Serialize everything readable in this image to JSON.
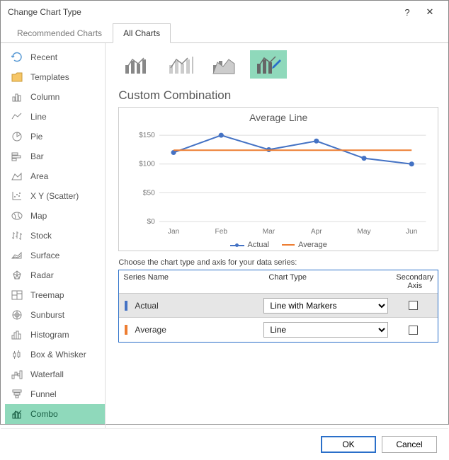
{
  "title": "Change Chart Type",
  "tabs": {
    "recommended": "Recommended Charts",
    "all": "All Charts"
  },
  "sidebar": {
    "items": [
      {
        "label": "Recent"
      },
      {
        "label": "Templates"
      },
      {
        "label": "Column"
      },
      {
        "label": "Line"
      },
      {
        "label": "Pie"
      },
      {
        "label": "Bar"
      },
      {
        "label": "Area"
      },
      {
        "label": "X Y (Scatter)"
      },
      {
        "label": "Map"
      },
      {
        "label": "Stock"
      },
      {
        "label": "Surface"
      },
      {
        "label": "Radar"
      },
      {
        "label": "Treemap"
      },
      {
        "label": "Sunburst"
      },
      {
        "label": "Histogram"
      },
      {
        "label": "Box & Whisker"
      },
      {
        "label": "Waterfall"
      },
      {
        "label": "Funnel"
      },
      {
        "label": "Combo"
      }
    ]
  },
  "section_title": "Custom Combination",
  "chart_data": {
    "type": "line",
    "title": "Average Line",
    "categories": [
      "Jan",
      "Feb",
      "Mar",
      "Apr",
      "May",
      "Jun"
    ],
    "series": [
      {
        "name": "Actual",
        "values": [
          120,
          150,
          125,
          140,
          110,
          100
        ],
        "color": "#4472c4",
        "markers": true
      },
      {
        "name": "Average",
        "values": [
          124,
          124,
          124,
          124,
          124,
          124
        ],
        "color": "#ed7d31",
        "markers": false
      }
    ],
    "yticks": [
      "$0",
      "$50",
      "$100",
      "$150"
    ],
    "ylim": [
      0,
      160
    ]
  },
  "series_section_label": "Choose the chart type and axis for your data series:",
  "series_columns": {
    "name": "Series Name",
    "type": "Chart Type",
    "axis": "Secondary Axis"
  },
  "series_rows": [
    {
      "swatch": "#4472c4",
      "name": "Actual",
      "type": "Line with Markers",
      "secondary": false
    },
    {
      "swatch": "#ed7d31",
      "name": "Average",
      "type": "Line",
      "secondary": false
    }
  ],
  "buttons": {
    "ok": "OK",
    "cancel": "Cancel"
  }
}
